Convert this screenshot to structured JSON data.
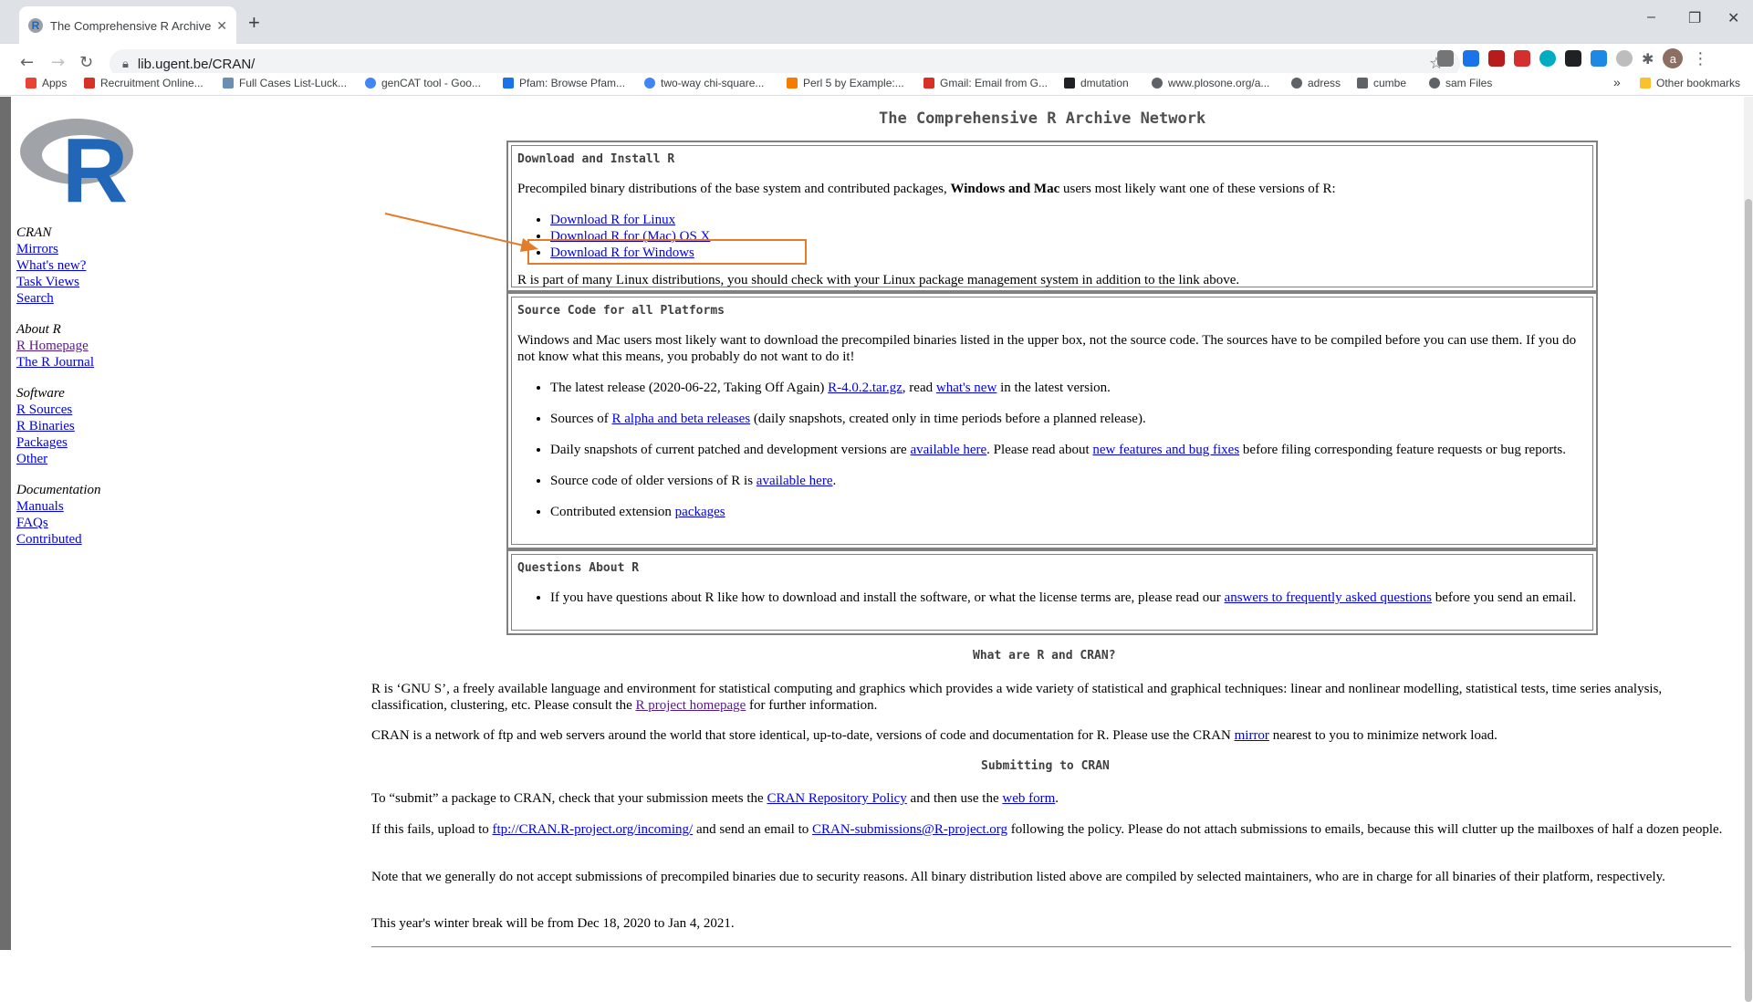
{
  "browser": {
    "tab_title": "The Comprehensive R Archive Ne",
    "tab_close": "✕",
    "new_tab": "+",
    "url": "lib.ugent.be/CRAN/",
    "avatar_letter": "a",
    "window_controls": {
      "minimize": "–",
      "restore": "❐",
      "close": "✕"
    },
    "bookmarks": [
      {
        "label": "Apps",
        "icon": "apps-grid-icon",
        "color": "#ea4335"
      },
      {
        "label": "Recruitment Online...",
        "icon": "gmail-icon",
        "color": "#d93025"
      },
      {
        "label": "Full Cases List-Luck...",
        "icon": "page-thumbnail-icon",
        "color": "#6b8fb3"
      },
      {
        "label": "genCAT tool - Goo...",
        "icon": "google-icon",
        "color": "#4285f4"
      },
      {
        "label": "Pfam: Browse Pfam...",
        "icon": "pfam-icon",
        "color": "#1a73e8"
      },
      {
        "label": "two-way chi-square...",
        "icon": "google-icon",
        "color": "#4285f4"
      },
      {
        "label": "Perl 5 by Example:...",
        "icon": "blogger-icon",
        "color": "#f57c00"
      },
      {
        "label": "Gmail: Email from G...",
        "icon": "gmail-icon",
        "color": "#d93025"
      },
      {
        "label": "dmutation",
        "icon": "dmutation-icon",
        "color": "#202124"
      },
      {
        "label": "www.plosone.org/a...",
        "icon": "globe-icon",
        "color": "#5f6368"
      },
      {
        "label": "adress",
        "icon": "globe-icon",
        "color": "#5f6368"
      },
      {
        "label": "cumbe",
        "icon": "list-icon",
        "color": "#5f6368"
      },
      {
        "label": "sam Files",
        "icon": "globe-icon",
        "color": "#5f6368"
      }
    ],
    "bookmarks_more": "»",
    "other_bookmarks": "Other bookmarks"
  },
  "sidebar": {
    "logo_letter": "R",
    "sections": [
      {
        "heading": "CRAN",
        "links": [
          "Mirrors",
          "What's new?",
          "Task Views",
          "Search"
        ]
      },
      {
        "heading": "About R",
        "links": [
          "R Homepage",
          "The R Journal"
        ]
      },
      {
        "heading": "Software",
        "links": [
          "R Sources",
          "R Binaries",
          "Packages",
          "Other"
        ]
      },
      {
        "heading": "Documentation",
        "links": [
          "Manuals",
          "FAQs",
          "Contributed"
        ]
      }
    ]
  },
  "main": {
    "title": "The Comprehensive R Archive Network",
    "download_box": {
      "heading": "Download and Install R",
      "intro_pre": "Precompiled binary distributions of the base system and contributed packages, ",
      "intro_bold": "Windows and Mac",
      "intro_post": " users most likely want one of these versions of R:",
      "links": [
        "Download R for Linux",
        "Download R for (Mac) OS X",
        "Download R for Windows"
      ],
      "footer": "R is part of many Linux distributions, you should check with your Linux package management system in addition to the link above."
    },
    "source_box": {
      "heading": "Source Code for all Platforms",
      "intro": "Windows and Mac users most likely want to download the precompiled binaries listed in the upper box, not the source code. The sources have to be compiled before you can use them. If you do not know what this means, you probably do not want to do it!",
      "item1_pre": "The latest release (2020-06-22, Taking Off Again) ",
      "item1_link": "R-4.0.2.tar.gz",
      "item1_mid": ", read ",
      "item1_link2": "what's new",
      "item1_post": " in the latest version.",
      "item2_pre": "Sources of ",
      "item2_link": "R alpha and beta releases",
      "item2_post": " (daily snapshots, created only in time periods before a planned release).",
      "item3_pre": "Daily snapshots of current patched and development versions are ",
      "item3_link": "available here",
      "item3_mid": ". Please read about ",
      "item3_link2": "new features and bug fixes",
      "item3_post": " before filing corresponding feature requests or bug reports.",
      "item4_pre": "Source code of older versions of R is ",
      "item4_link": "available here",
      "item4_post": ".",
      "item5_pre": "Contributed extension ",
      "item5_link": "packages"
    },
    "questions_box": {
      "heading": "Questions About R",
      "item_pre": "If you have questions about R like how to download and install the software, or what the license terms are, please read our ",
      "item_link": "answers to frequently asked questions",
      "item_post": " before you send an email."
    },
    "what_heading": "What are R and CRAN?",
    "what_p1_pre": "R is ‘GNU S’, a freely available language and environment for statistical computing and graphics which provides a wide variety of statistical and graphical techniques: linear and nonlinear modelling, statistical tests, time series analysis, classification, clustering, etc. Please consult the ",
    "what_p1_link": "R project homepage",
    "what_p1_post": " for further information.",
    "what_p2_pre": "CRAN is a network of ftp and web servers around the world that store identical, up-to-date, versions of code and documentation for R. Please use the CRAN ",
    "what_p2_link": "mirror",
    "what_p2_post": " nearest to you to minimize network load.",
    "submit_heading": "Submitting to CRAN",
    "submit_p1_pre": "To “submit” a package to CRAN, check that your submission meets the ",
    "submit_p1_link": "CRAN Repository Policy",
    "submit_p1_mid": " and then use the ",
    "submit_p1_link2": "web form",
    "submit_p1_post": ".",
    "submit_p2_pre": "If this fails, upload to ",
    "submit_p2_link": "ftp://CRAN.R-project.org/incoming/",
    "submit_p2_mid": " and send an email to ",
    "submit_p2_link2": "CRAN-submissions@R-project.org",
    "submit_p2_post": " following the policy. Please do not attach submissions to emails, because this will clutter up the mailboxes of half a dozen people.",
    "submit_p3": "Note that we generally do not accept submissions of precompiled binaries due to security reasons. All binary distribution listed above are compiled by selected maintainers, who are in charge for all binaries of their platform, respectively.",
    "submit_p4": "This year's winter break will be from Dec 18, 2020 to Jan 4, 2021."
  },
  "colors": {
    "highlight": "#e07c2a",
    "link": "#0000ee",
    "visited": "#551a8b"
  }
}
